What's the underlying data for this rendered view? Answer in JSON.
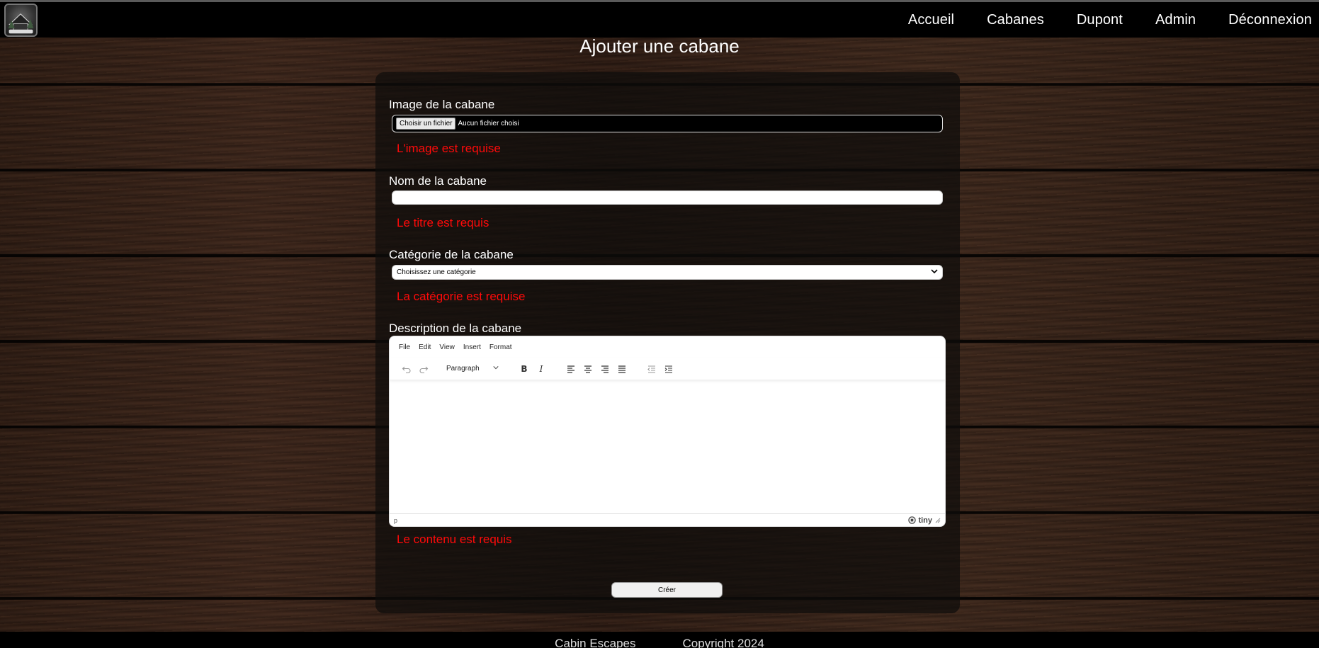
{
  "nav": {
    "brand": "CABIN ESCAPES",
    "items": [
      {
        "label": "Accueil"
      },
      {
        "label": "Cabanes"
      },
      {
        "label": "Dupont"
      },
      {
        "label": "Admin"
      },
      {
        "label": "Déconnexion"
      }
    ]
  },
  "page": {
    "title": "Ajouter une cabane"
  },
  "form": {
    "image": {
      "label": "Image de la cabane",
      "button": "Choisir un fichier",
      "status": "Aucun fichier choisi",
      "error": "L'image est requise"
    },
    "name": {
      "label": "Nom de la cabane",
      "value": "",
      "error": "Le titre est requis"
    },
    "category": {
      "label": "Catégorie de la cabane",
      "selected": "Choisissez une catégorie",
      "error": "La catégorie est requise"
    },
    "description": {
      "label": "Description de la cabane",
      "error": "Le contenu est requis"
    },
    "submit": "Créer"
  },
  "editor": {
    "menus": [
      "File",
      "Edit",
      "View",
      "Insert",
      "Format"
    ],
    "block_format": "Paragraph",
    "path": "p",
    "brand": "tiny"
  },
  "footer": {
    "left": "Cabin Escapes",
    "right": "Copyright 2024"
  }
}
